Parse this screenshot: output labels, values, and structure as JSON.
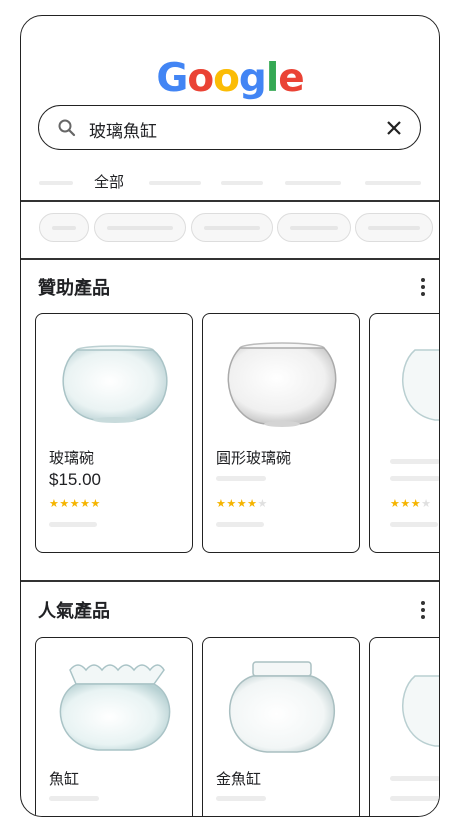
{
  "search": {
    "query": "玻璃魚缸"
  },
  "tabs": {
    "active_label": "全部"
  },
  "sponsored": {
    "title": "贊助產品",
    "products": [
      {
        "name": "玻璃碗",
        "price": "$15.00",
        "rating": 5
      },
      {
        "name": "圓形玻璃碗",
        "price": "",
        "rating": 4
      },
      {
        "name": "",
        "price": "",
        "rating": 3
      }
    ]
  },
  "popular": {
    "title": "人氣產品",
    "products": [
      {
        "name": "魚缸"
      },
      {
        "name": "金魚缸"
      },
      {
        "name": ""
      }
    ]
  },
  "colors": {
    "google_blue": "#4285F4",
    "google_red": "#EA4335",
    "google_yellow": "#FBBC05",
    "google_green": "#34A853",
    "star": "#F5B400"
  }
}
